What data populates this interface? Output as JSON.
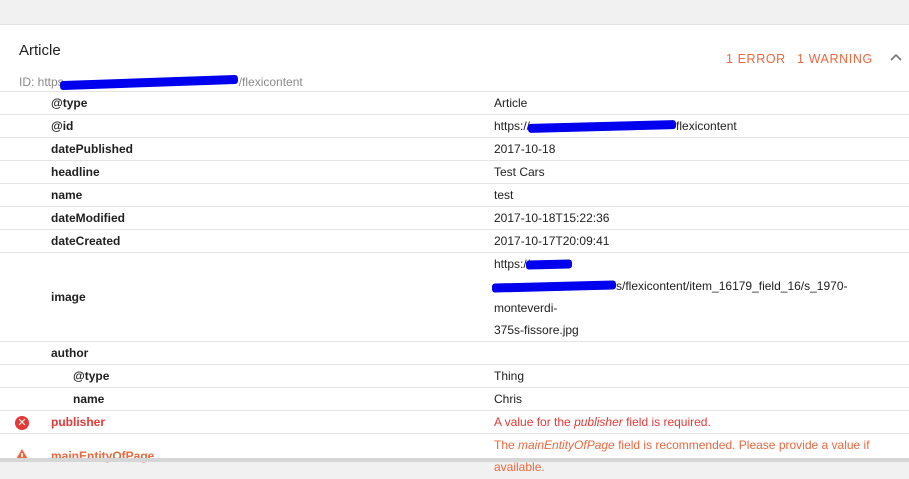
{
  "colors": {
    "error": "#e53935",
    "warning": "#e8683f",
    "redaction": "#0000ee"
  },
  "header": {
    "title": "Article",
    "id_prefix": "ID: https",
    "id_suffix": "/flexicontent",
    "error_count": "1 ERROR",
    "warning_count": "1 WARNING",
    "collapse_icon": "chevron-up-icon"
  },
  "rows": {
    "type": {
      "key": "@type",
      "value": "Article"
    },
    "id": {
      "key": "@id",
      "value_prefix": "https://",
      "value_suffix": "flexicontent"
    },
    "date_published": {
      "key": "datePublished",
      "value": "2017-10-18"
    },
    "headline": {
      "key": "headline",
      "value": "Test Cars"
    },
    "name": {
      "key": "name",
      "value": "test"
    },
    "date_modified": {
      "key": "dateModified",
      "value": "2017-10-18T15:22:36"
    },
    "date_created": {
      "key": "dateCreated",
      "value": "2017-10-17T20:09:41"
    },
    "image": {
      "key": "image",
      "line1": "https://",
      "line2": "s/flexicontent/item_16179_field_16/s_1970-monteverdi-",
      "line3": "375s-fissore.jpg"
    },
    "author": {
      "key": "author"
    },
    "author_type": {
      "key": "@type",
      "value": "Thing"
    },
    "author_name": {
      "key": "name",
      "value": "Chris"
    },
    "publisher": {
      "key": "publisher",
      "icon": "error-icon",
      "msg_pre": "A value for the ",
      "msg_field": "publisher",
      "msg_post": " field is required."
    },
    "main_entity": {
      "key": "mainEntityOfPage",
      "icon": "warning-icon",
      "msg_pre": "The ",
      "msg_field": "mainEntityOfPage",
      "msg_post": " field is recommended. Please provide a value if available."
    }
  }
}
